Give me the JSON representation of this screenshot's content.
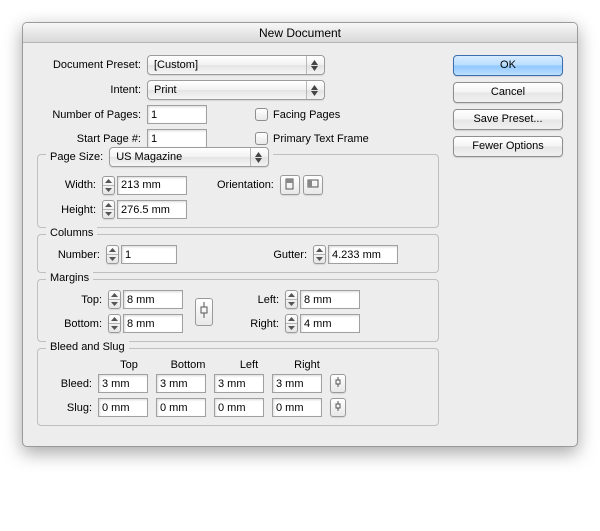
{
  "window": {
    "title": "New Document"
  },
  "side": {
    "ok": "OK",
    "cancel": "Cancel",
    "save_preset": "Save Preset...",
    "fewer_options": "Fewer Options"
  },
  "labels": {
    "document_preset": "Document Preset:",
    "intent": "Intent:",
    "number_of_pages": "Number of Pages:",
    "start_page": "Start Page #:",
    "facing_pages": "Facing Pages",
    "primary_text_frame": "Primary Text Frame",
    "page_size": "Page Size:",
    "width": "Width:",
    "height": "Height:",
    "orientation": "Orientation:",
    "columns": "Columns",
    "number": "Number:",
    "gutter": "Gutter:",
    "margins": "Margins",
    "top": "Top:",
    "bottom": "Bottom:",
    "left": "Left:",
    "right": "Right:",
    "bleed_slug": "Bleed and Slug",
    "col_top": "Top",
    "col_bottom": "Bottom",
    "col_left": "Left",
    "col_right": "Right",
    "bleed": "Bleed:",
    "slug": "Slug:"
  },
  "values": {
    "document_preset": "[Custom]",
    "intent": "Print",
    "number_of_pages": "1",
    "start_page": "1",
    "page_size": "US Magazine",
    "width": "213 mm",
    "height": "276.5 mm",
    "columns_number": "1",
    "gutter": "4.233 mm",
    "margins": {
      "top": "8 mm",
      "bottom": "8 mm",
      "left": "8 mm",
      "right": "4 mm"
    },
    "bleed": {
      "top": "3 mm",
      "bottom": "3 mm",
      "left": "3 mm",
      "right": "3 mm"
    },
    "slug": {
      "top": "0 mm",
      "bottom": "0 mm",
      "left": "0 mm",
      "right": "0 mm"
    }
  }
}
